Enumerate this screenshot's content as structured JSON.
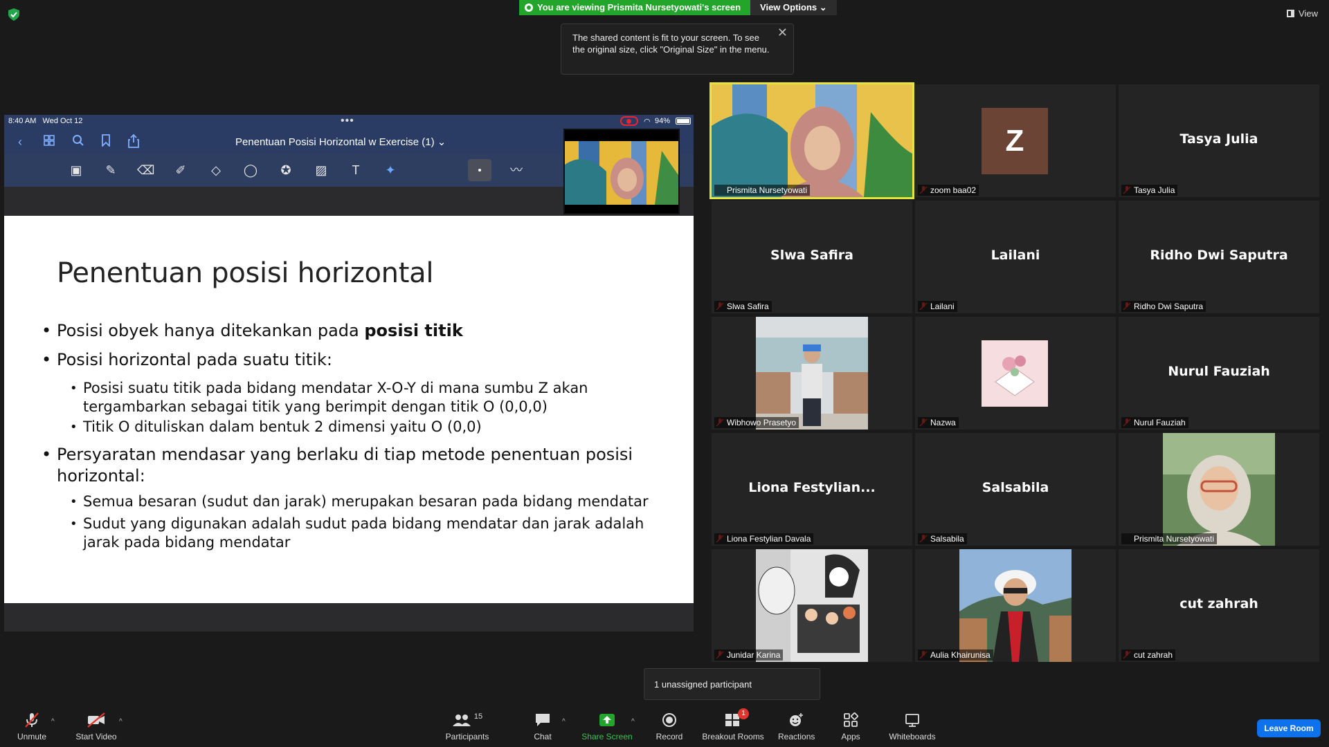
{
  "banner": {
    "viewing_text": "You are viewing Prismita Nursetyowati's screen",
    "view_options": "View Options",
    "view_label": "View"
  },
  "tooltip": {
    "text": "The shared content is fit to your screen. To see the original size, click \"Original Size\" in the menu."
  },
  "ipad": {
    "time": "8:40 AM",
    "date": "Wed Oct 12",
    "battery": "94%",
    "doc_title": "Penentuan Posisi Horizontal w Exercise (1) ⌄"
  },
  "slide": {
    "title": "Penentuan posisi horizontal",
    "b1_prefix": "Posisi obyek hanya ditekankan pada ",
    "b1_bold": "posisi titik",
    "b2": "Posisi horizontal pada suatu titik:",
    "b2_1_l1": "Posisi suatu titik pada bidang mendatar X-O-Y di mana sumbu Z akan",
    "b2_1_l2": "tergambarkan sebagai titik yang berimpit dengan titik O (0,0,0)",
    "b2_2": "Titik O dituliskan dalam bentuk 2 dimensi yaitu O (0,0)",
    "b3_l1": "Persyaratan mendasar yang berlaku di tiap metode penentuan posisi",
    "b3_l2": "horizontal:",
    "b3_1": "Semua besaran (sudut dan jarak) merupakan besaran pada bidang mendatar",
    "b3_2_l1": "Sudut yang digunakan adalah sudut pada bidang mendatar dan jarak adalah",
    "b3_2_l2": "jarak pada bidang mendatar"
  },
  "participants_tiles": [
    {
      "label": "Prismita Nursetyowati"
    },
    {
      "label": "zoom baa02",
      "avatar_letter": "Z"
    },
    {
      "name": "Tasya Julia",
      "label": "Tasya Julia"
    },
    {
      "name": "Slwa Safira",
      "label": "Slwa Safira"
    },
    {
      "name": "Lailani",
      "label": "Lailani"
    },
    {
      "name": "Ridho Dwi Saputra",
      "label": "Ridho Dwi Saputra"
    },
    {
      "label": "Wibhowo Prasetyo"
    },
    {
      "label": "Nazwa"
    },
    {
      "name": "Nurul Fauziah",
      "label": "Nurul Fauziah"
    },
    {
      "name": "Liona  Festylian...",
      "label": "Liona Festylian Davala"
    },
    {
      "name": "Salsabila",
      "label": "Salsabila"
    },
    {
      "label": "Prismita Nursetyowati"
    },
    {
      "label": "Junidar Karina"
    },
    {
      "label": "Aulia Khairunisa"
    },
    {
      "name": "cut zahrah",
      "label": "cut zahrah"
    }
  ],
  "breakout_popup": "1 unassigned participant",
  "toolbar": {
    "unmute": "Unmute",
    "start_video": "Start Video",
    "participants": "Participants",
    "participants_count": "15",
    "chat": "Chat",
    "share_screen": "Share Screen",
    "record": "Record",
    "breakout_rooms": "Breakout Rooms",
    "breakout_badge": "1",
    "reactions": "Reactions",
    "apps": "Apps",
    "whiteboards": "Whiteboards",
    "leave_room": "Leave Room"
  },
  "colors": {
    "share_green": "#22a52a",
    "active_speaker": "#e8e33c",
    "leave_blue": "#0e72ed",
    "muted_red": "#e0362f"
  }
}
